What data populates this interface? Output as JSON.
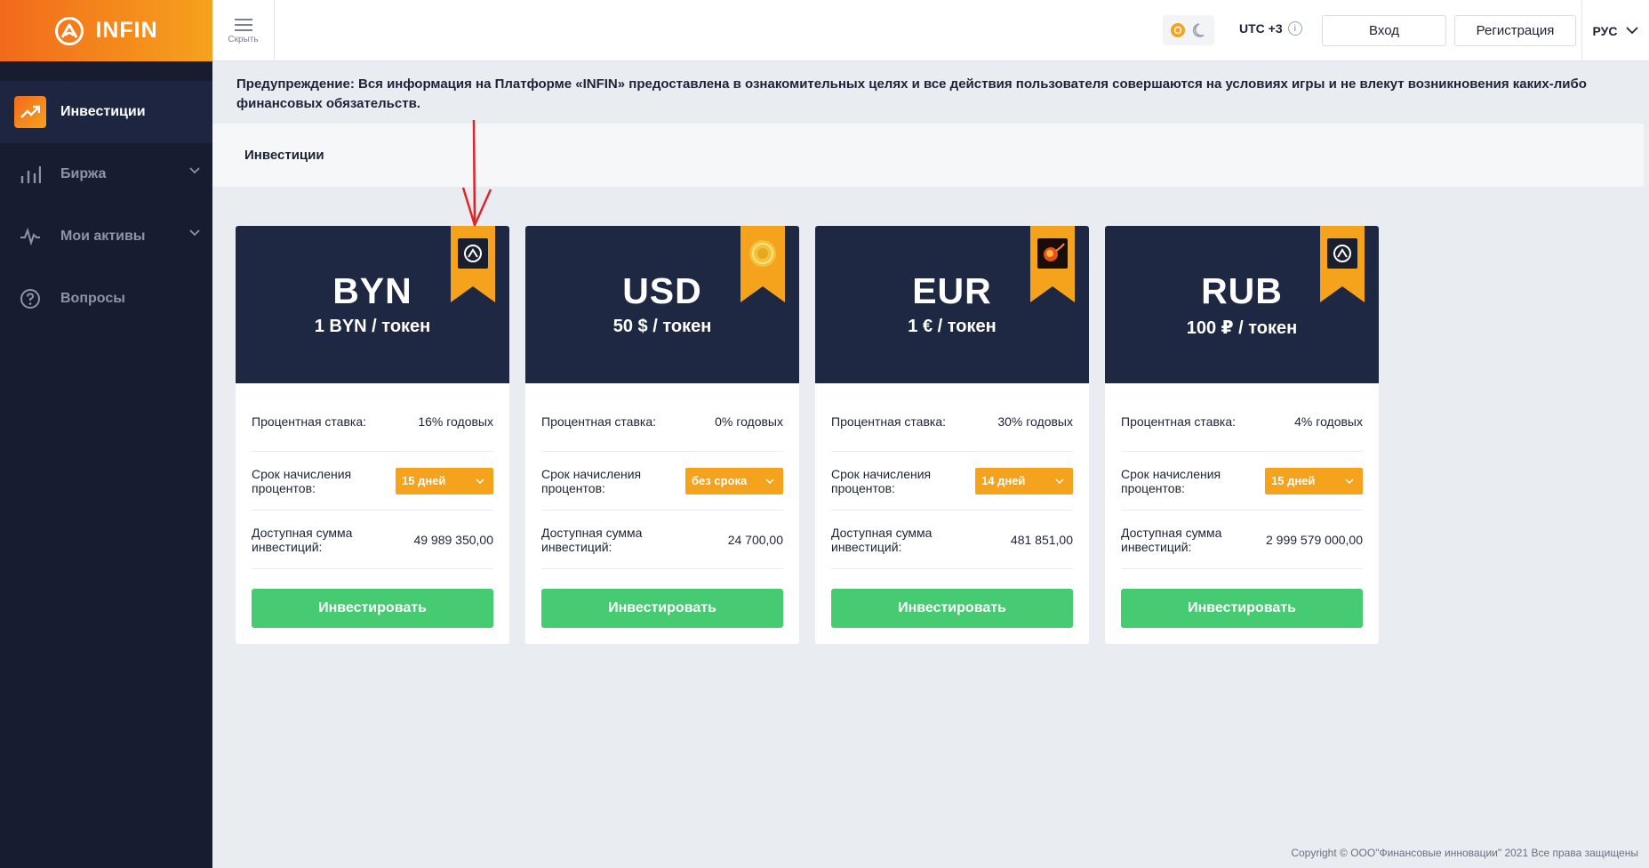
{
  "brand": {
    "name": "INFIN"
  },
  "topbar": {
    "hide_label": "Скрыть",
    "timezone": "UTC +3",
    "info_glyph": "i",
    "login": "Вход",
    "register": "Регистрация",
    "language": "РУС"
  },
  "sidebar": {
    "items": [
      {
        "label": "Инвестиции",
        "icon": "trend-up-icon",
        "active": true
      },
      {
        "label": "Биржа",
        "icon": "bar-chart-icon",
        "has_submenu": true
      },
      {
        "label": "Мои активы",
        "icon": "activity-icon",
        "has_submenu": true
      },
      {
        "label": "Вопросы",
        "icon": "question-icon"
      }
    ]
  },
  "warning": "Предупреждение: Вся информация на Платформе «INFIN» предоставлена в ознакомительных целях и все действия пользователя совершаются на условиях игры и не влекут возникновения каких-либо финансовых обязательств.",
  "section_title": "Инвестиции",
  "cards": [
    {
      "currency": "BYN",
      "rate": "1 BYN / токен",
      "rate_label": "Процентная ставка:",
      "rate_value": "16% годовых",
      "term_label": "Срок начисления процентов:",
      "term_value": "15 дней",
      "sum_label": "Доступная сумма инвестиций:",
      "sum_value": "49 989 350,00",
      "button": "Инвестировать",
      "emblem": "infin-logo-icon"
    },
    {
      "currency": "USD",
      "rate": "50 $ / токен",
      "rate_label": "Процентная ставка:",
      "rate_value": "0% годовых",
      "term_label": "Срок начисления процентов:",
      "term_value": "без срока",
      "sum_label": "Доступная сумма инвестиций:",
      "sum_value": "24 700,00",
      "button": "Инвестировать",
      "emblem": "gold-coin-icon"
    },
    {
      "currency": "EUR",
      "rate": "1 € / токен",
      "rate_label": "Процентная ставка:",
      "rate_value": "30% годовых",
      "term_label": "Срок начисления процентов:",
      "term_value": "14 дней",
      "sum_label": "Доступная сумма инвестиций:",
      "sum_value": "481 851,00",
      "button": "Инвестировать",
      "emblem": "fire-planet-icon"
    },
    {
      "currency": "RUB",
      "rate": "100 ₽ / токен",
      "rate_label": "Процентная ставка:",
      "rate_value": "4% годовых",
      "term_label": "Срок начисления процентов:",
      "term_value": "15 дней",
      "sum_label": "Доступная сумма инвестиций:",
      "sum_value": "2 999 579 000,00",
      "button": "Инвестировать",
      "emblem": "infin-logo-icon"
    }
  ],
  "colors": {
    "accent": "#f5a21c",
    "card_header": "#1f2842",
    "sidebar": "#171c31",
    "invest": "#46ca72",
    "annotation": "#d9262b"
  },
  "copyright": "Copyright © ООО\"Финансовые инновации\" 2021 Все права защищены"
}
